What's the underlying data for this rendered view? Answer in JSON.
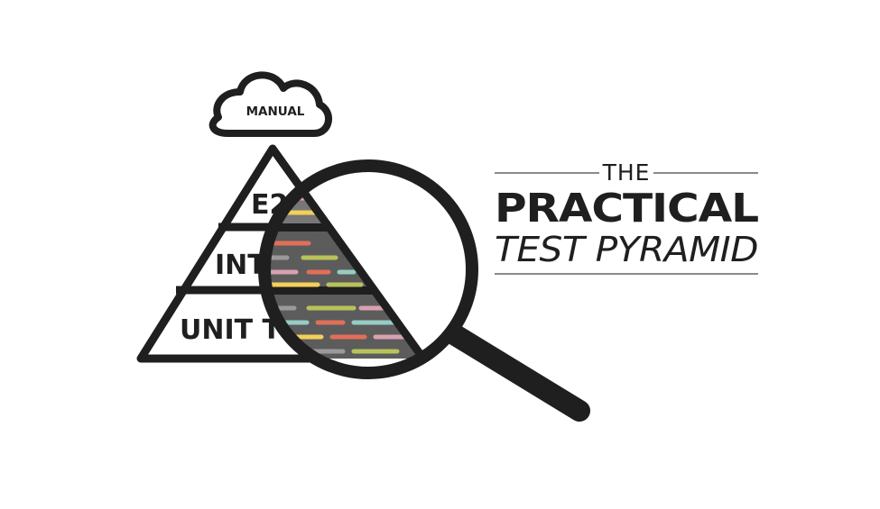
{
  "cloud": {
    "label": "MANUAL"
  },
  "pyramid": {
    "layers": [
      {
        "label": "E2E"
      },
      {
        "label": "INTEGRATION"
      },
      {
        "label": "UNIT TESTS"
      }
    ]
  },
  "title": {
    "the": "THE",
    "practical": "PRACTICAL",
    "test_pyramid": "TEST PYRAMID"
  },
  "colors": {
    "ink": "#1f1f1f",
    "lens_dark": "#5c5c5c",
    "lens_light": "#777777",
    "code_pink": "#d9a1b0",
    "code_yellow": "#f4cf59",
    "code_green": "#b8c25a",
    "code_red": "#e16f57",
    "code_teal": "#96ccc3",
    "code_gray": "#9a9a9a",
    "rule": "#8a8a8a"
  }
}
